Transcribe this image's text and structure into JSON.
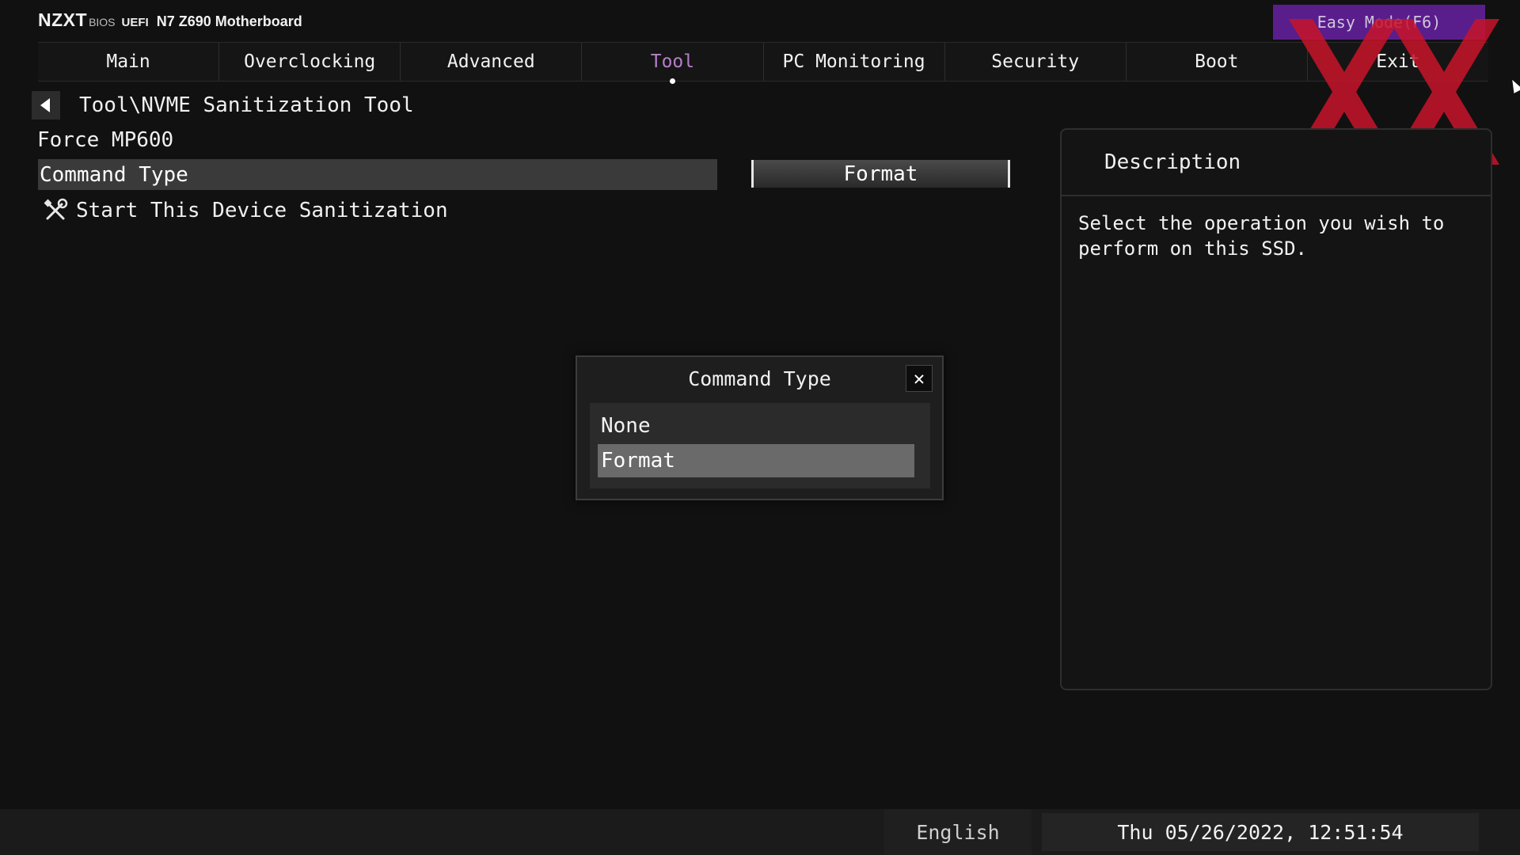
{
  "header": {
    "logo": "NZXT",
    "bios_label": "BIOS",
    "uefi_label": "UEFI",
    "model": "N7 Z690 Motherboard",
    "easy_mode": "Easy Mode(F6)"
  },
  "tabs": [
    {
      "label": "Main"
    },
    {
      "label": "Overclocking"
    },
    {
      "label": "Advanced"
    },
    {
      "label": "Tool",
      "active": true
    },
    {
      "label": "PC Monitoring"
    },
    {
      "label": "Security"
    },
    {
      "label": "Boot"
    },
    {
      "label": "Exit"
    }
  ],
  "breadcrumb": "Tool\\NVME Sanitization Tool",
  "device": "Force MP600",
  "command_type": {
    "label": "Command Type",
    "value": "Format"
  },
  "start_item": "Start This Device Sanitization",
  "description": {
    "title": "Description",
    "text": "Select the operation you wish to perform on this SSD."
  },
  "dialog": {
    "title": "Command Type",
    "close": "✕",
    "options": [
      {
        "label": "None"
      },
      {
        "label": "Format",
        "selected": true
      }
    ]
  },
  "footer": {
    "language": "English",
    "datetime": "Thu 05/26/2022, 12:51:54"
  },
  "colors": {
    "accent_tab": "#b67fc8",
    "easy_mode_bg": "#5a1e8c",
    "watermark": "#c8142a"
  }
}
